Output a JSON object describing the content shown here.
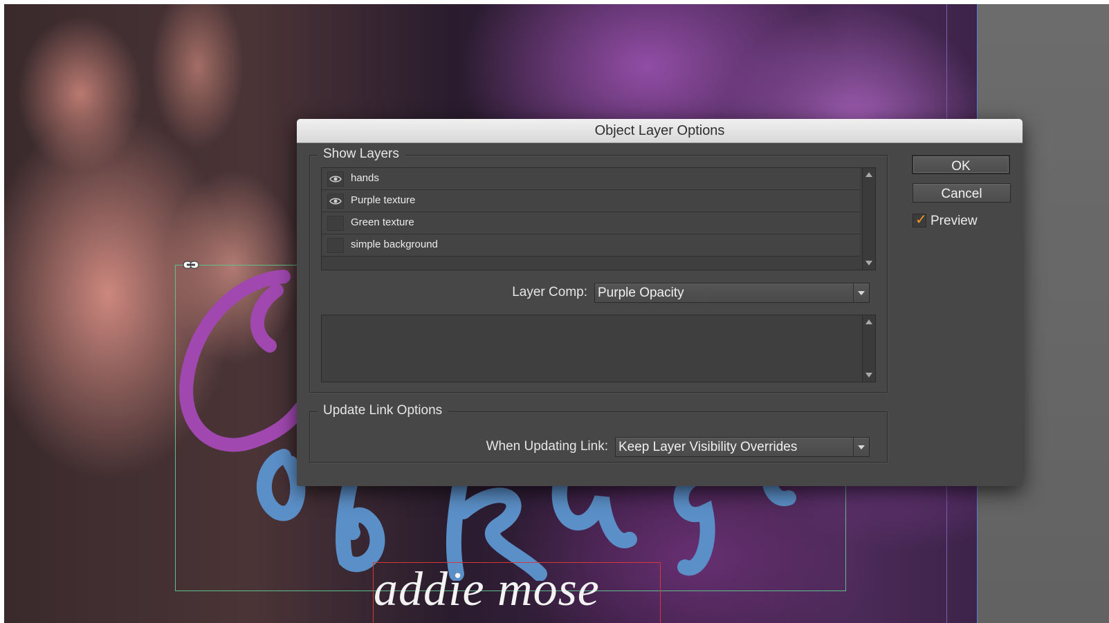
{
  "dialog": {
    "title": "Object Layer Options",
    "show_layers": {
      "legend": "Show Layers",
      "layers": [
        {
          "name": "hands",
          "visible": true
        },
        {
          "name": "Purple texture",
          "visible": true
        },
        {
          "name": "Green texture",
          "visible": false
        },
        {
          "name": "simple background",
          "visible": false
        }
      ],
      "layer_comp_label": "Layer Comp:",
      "layer_comp_value": "Purple Opacity"
    },
    "update_link": {
      "legend": "Update Link Options",
      "when_updating_label": "When Updating Link:",
      "when_updating_value": "Keep Layer Visibility Overrides"
    },
    "buttons": {
      "ok": "OK",
      "cancel": "Cancel"
    },
    "preview": {
      "label": "Preview",
      "checked": true
    }
  },
  "artwork": {
    "text": "addie mose"
  },
  "colors": {
    "check_accent": "#ff9a1f",
    "frame_green": "#5fbf8a",
    "frame_red": "#d23a3a"
  },
  "icons": {
    "visibility": "eye-icon",
    "link": "link-icon"
  }
}
